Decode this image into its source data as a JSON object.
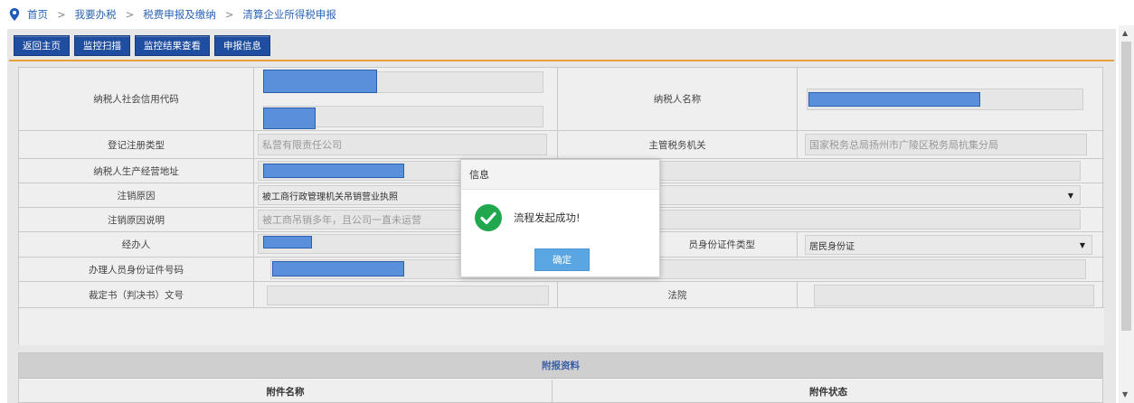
{
  "breadcrumb": {
    "items": [
      "首页",
      "我要办税",
      "税费申报及缴纳",
      "清算企业所得税申报"
    ],
    "separator": ">"
  },
  "toolbar": {
    "buttons": [
      "返回主页",
      "监控扫描",
      "监控结果查看",
      "申报信息"
    ]
  },
  "form": {
    "credit_code_label": "纳税人社会信用代码",
    "taxpayer_name_label": "纳税人名称",
    "reg_type_label": "登记注册类型",
    "reg_type_value": "私营有限责任公司",
    "tax_authority_label": "主管税务机关",
    "tax_authority_value": "国家税务总局扬州市广陵区税务局杭集分局",
    "address_label": "纳税人生产经营地址",
    "cancel_reason_label": "注销原因",
    "cancel_reason_value": "被工商行政管理机关吊销营业执照",
    "cancel_desc_label": "注销原因说明",
    "cancel_desc_value": "被工商吊销多年，且公司一直未运营",
    "agent_label": "经办人",
    "agent_id_type_label": "员身份证件类型",
    "agent_id_type_value": "居民身份证",
    "handler_id_label": "办理人员身份证件号码",
    "ruling_label": "裁定书（判决书）文号",
    "court_label": "法院"
  },
  "attachments": {
    "title": "附报资料",
    "col_name": "附件名称",
    "col_status": "附件状态"
  },
  "modal": {
    "title": "信息",
    "message": "流程发起成功!",
    "confirm": "确定"
  },
  "colors": {
    "primary_button": "#1f4d9f",
    "accent_line": "#e8a23a",
    "success": "#21a84f",
    "confirm_button": "#5aa6e3"
  },
  "icons": {
    "location": "location-pin-icon",
    "success": "check-circle-icon",
    "select": "caret-down-icon"
  }
}
